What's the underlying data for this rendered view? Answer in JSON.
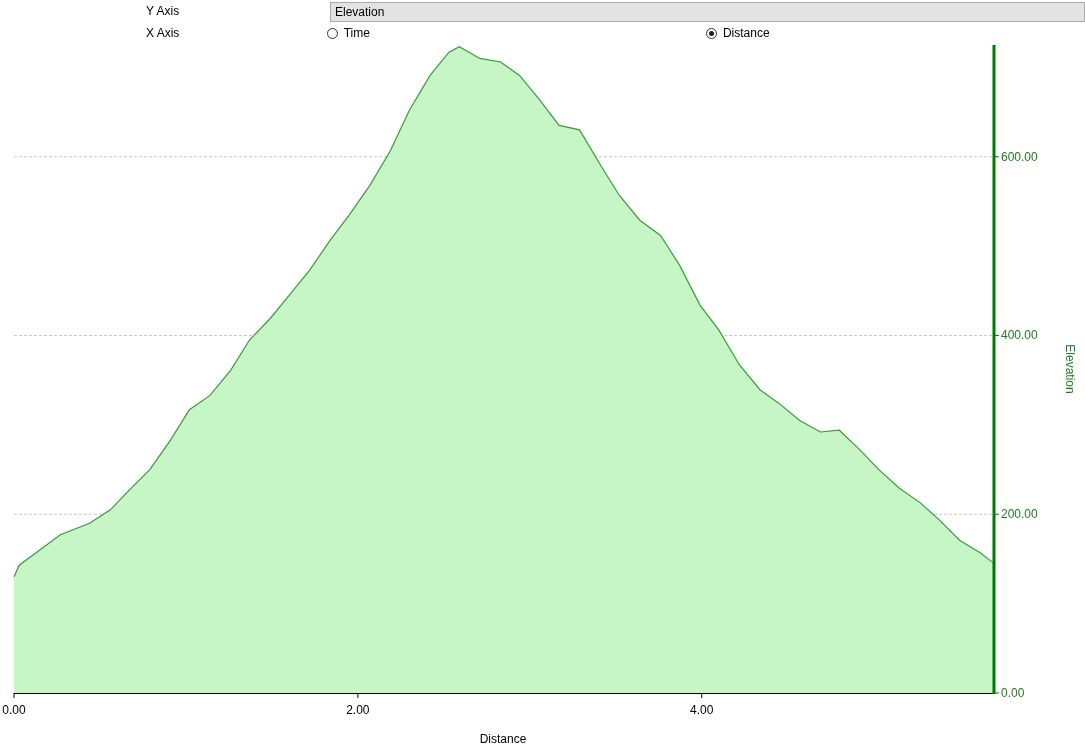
{
  "y_axis": {
    "label": "Y Axis",
    "value": "Elevation"
  },
  "x_axis": {
    "label": "X Axis",
    "options": [
      {
        "label": "Time",
        "selected": false
      },
      {
        "label": "Distance",
        "selected": true
      }
    ]
  },
  "chart": {
    "chart_data": {
      "type": "area",
      "xlabel": "Distance",
      "ylabel": "Elevation",
      "x": [
        0,
        0.03,
        0.15,
        0.27,
        0.44,
        0.56,
        0.67,
        0.79,
        0.91,
        1.02,
        1.14,
        1.26,
        1.37,
        1.49,
        1.6,
        1.72,
        1.84,
        1.95,
        2.07,
        2.19,
        2.3,
        2.42,
        2.53,
        2.59,
        2.71,
        2.83,
        2.94,
        3.06,
        3.17,
        3.29,
        3.41,
        3.52,
        3.64,
        3.76,
        3.87,
        3.99,
        4.1,
        4.22,
        4.34,
        4.45,
        4.57,
        4.69,
        4.8,
        4.92,
        5.03,
        5.15,
        5.27,
        5.38,
        5.5,
        5.62,
        5.7
      ],
      "series": [
        {
          "color": "#3a9a3a",
          "values": [
            130,
            143,
            160,
            177,
            190,
            205,
            227,
            250,
            283,
            317,
            333,
            361,
            395,
            419,
            445,
            473,
            507,
            535,
            568,
            607,
            652,
            691,
            717,
            723,
            710,
            706,
            691,
            663,
            635,
            630,
            591,
            557,
            529,
            512,
            479,
            434,
            406,
            367,
            339,
            324,
            305,
            292,
            294,
            272,
            250,
            229,
            213,
            194,
            171,
            157,
            145
          ]
        }
      ],
      "grid": true,
      "xlim": [
        0,
        5.7
      ],
      "ylim": [
        0,
        725
      ],
      "xticks": [
        {
          "value": 0,
          "label": "0.00"
        },
        {
          "value": 2,
          "label": "2.00"
        },
        {
          "value": 4,
          "label": "4.00"
        }
      ],
      "yticks": [
        {
          "value": 0,
          "label": "0.00"
        },
        {
          "value": 200,
          "label": "200.00"
        },
        {
          "value": 400,
          "label": "400.00"
        },
        {
          "value": 600,
          "label": "600.00"
        }
      ]
    }
  }
}
